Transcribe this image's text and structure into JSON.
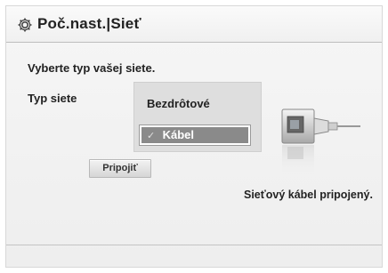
{
  "header": {
    "icon": "gear-icon",
    "title": "Poč.nast.|Sieť"
  },
  "main": {
    "prompt": "Vyberte typ vašej siete.",
    "network_type_label": "Typ siete",
    "options": [
      {
        "label": "Bezdrôtové",
        "selected": false
      },
      {
        "label": "Kábel",
        "selected": true,
        "check": "✓"
      }
    ],
    "connect_button_label": "Pripojiť",
    "status": "Sieťový kábel pripojený.",
    "graphic": "ethernet-cable-icon"
  },
  "colors": {
    "selected_background": "#8a8a8a",
    "panel_background": "#dedede",
    "window_background": "#f2f2f2"
  }
}
